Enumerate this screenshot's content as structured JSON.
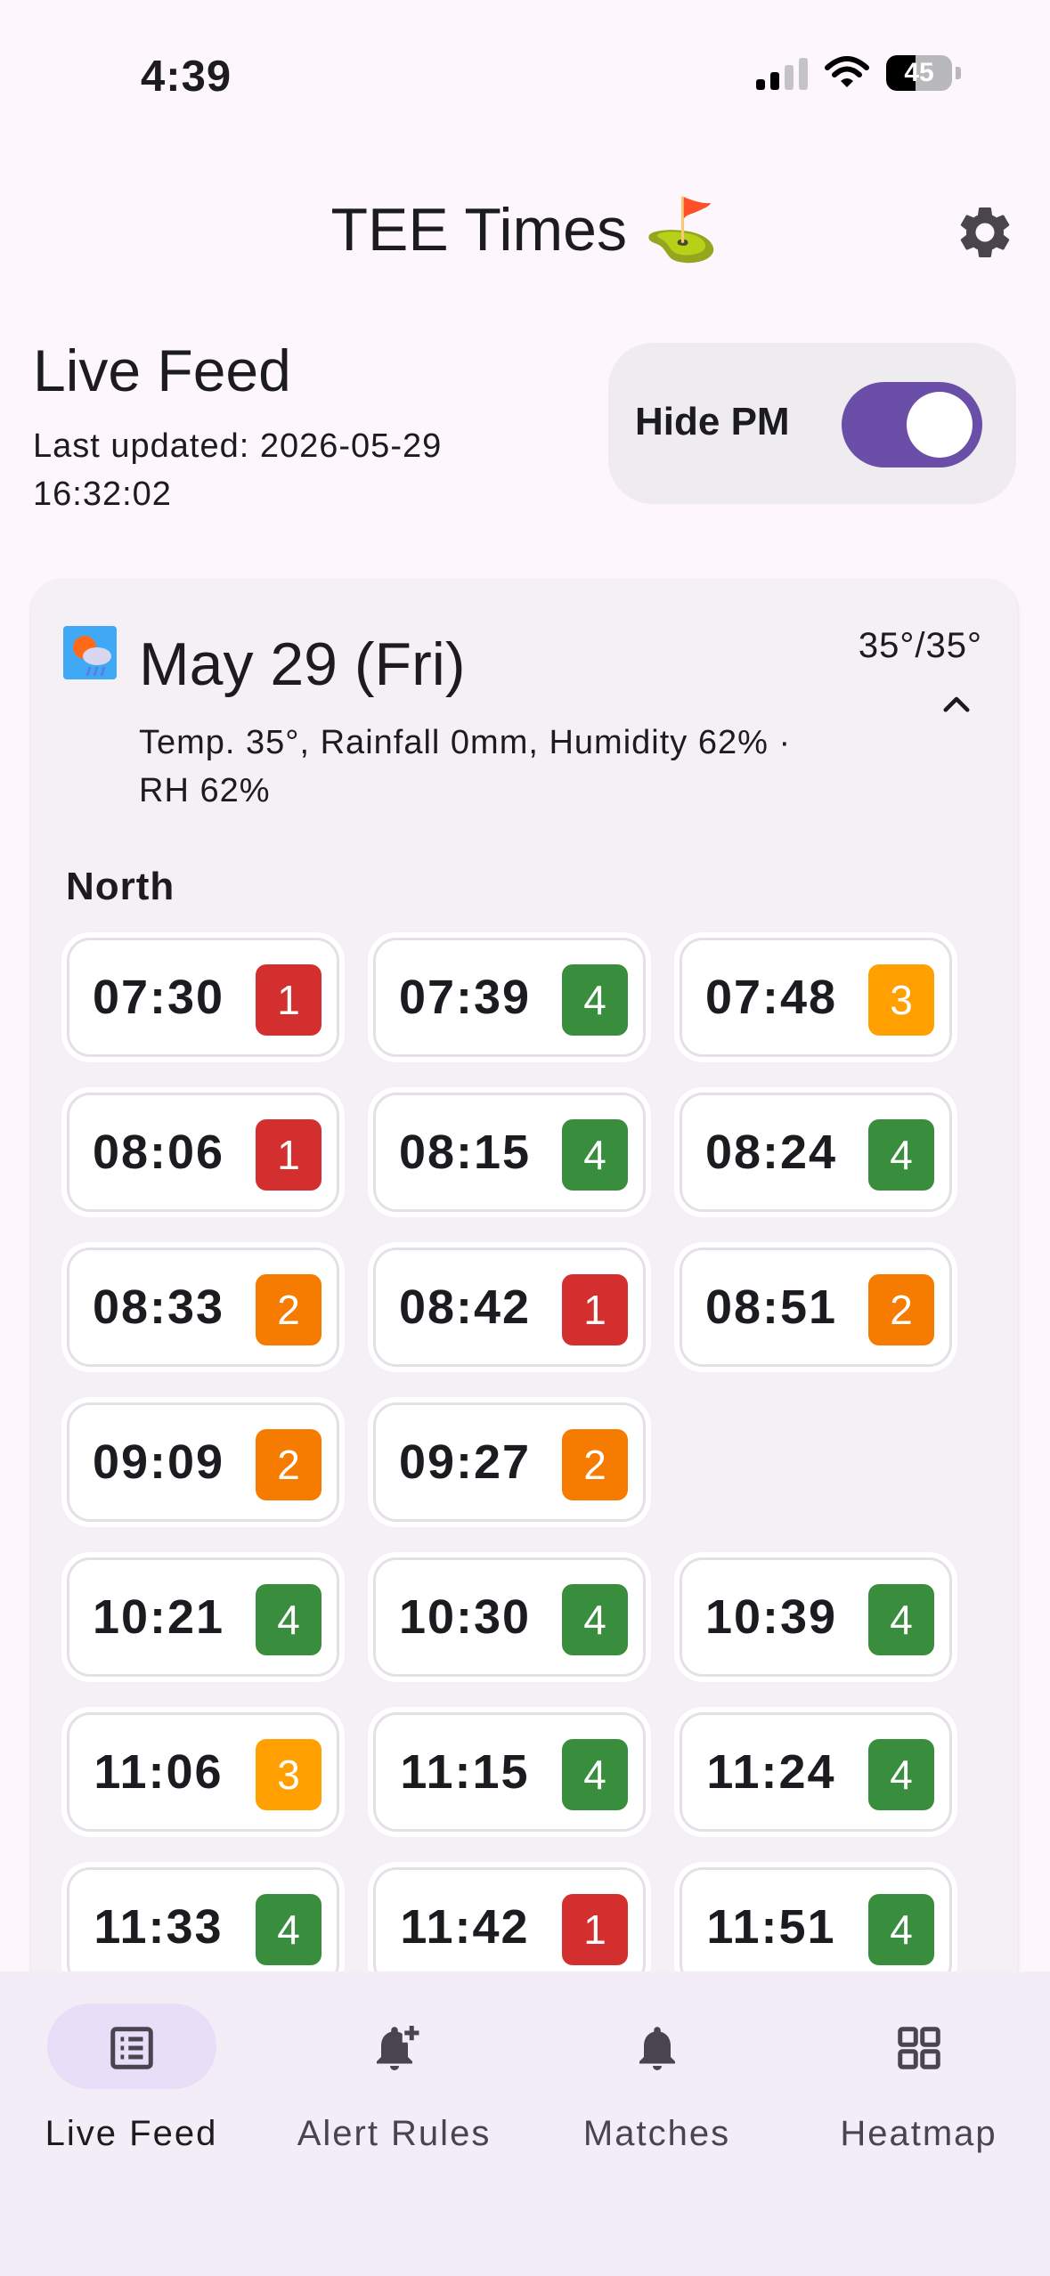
{
  "status": {
    "time": "4:39",
    "battery": "45",
    "battery_level": 0.45
  },
  "header": {
    "title": "TEE Times ⛳"
  },
  "feed": {
    "title": "Live Feed",
    "last_updated": "Last updated: 2026-05-29 16:32:02",
    "hide_pm_label": "Hide PM",
    "hide_pm_on": true
  },
  "day": {
    "title": "May 29 (Fri)",
    "temp_range": "35°/35°",
    "weather": "Temp. 35°, Rainfall 0mm, Humidity 62% · RH 62%",
    "section": "North"
  },
  "colors": {
    "red": "#d32f2f",
    "green": "#388e3c",
    "orange": "#f57c00",
    "amber": "#ffa000",
    "accent": "#6a4ea8"
  },
  "slots": [
    {
      "time": "07:30",
      "count": "1",
      "color": "red"
    },
    {
      "time": "07:39",
      "count": "4",
      "color": "green"
    },
    {
      "time": "07:48",
      "count": "3",
      "color": "amber"
    },
    {
      "time": "08:06",
      "count": "1",
      "color": "red"
    },
    {
      "time": "08:15",
      "count": "4",
      "color": "green"
    },
    {
      "time": "08:24",
      "count": "4",
      "color": "green"
    },
    {
      "time": "08:33",
      "count": "2",
      "color": "orange"
    },
    {
      "time": "08:42",
      "count": "1",
      "color": "red"
    },
    {
      "time": "08:51",
      "count": "2",
      "color": "orange"
    },
    {
      "time": "09:09",
      "count": "2",
      "color": "orange"
    },
    {
      "time": "09:27",
      "count": "2",
      "color": "orange"
    },
    null,
    {
      "time": "10:21",
      "count": "4",
      "color": "green"
    },
    {
      "time": "10:30",
      "count": "4",
      "color": "green"
    },
    {
      "time": "10:39",
      "count": "4",
      "color": "green"
    },
    {
      "time": "11:06",
      "count": "3",
      "color": "amber"
    },
    {
      "time": "11:15",
      "count": "4",
      "color": "green"
    },
    {
      "time": "11:24",
      "count": "4",
      "color": "green"
    },
    {
      "time": "11:33",
      "count": "4",
      "color": "green"
    },
    {
      "time": "11:42",
      "count": "1",
      "color": "red"
    },
    {
      "time": "11:51",
      "count": "4",
      "color": "green"
    }
  ],
  "nav": [
    {
      "label": "Live Feed",
      "icon": "list-icon",
      "active": true
    },
    {
      "label": "Alert Rules",
      "icon": "bell-plus-icon",
      "active": false
    },
    {
      "label": "Matches",
      "icon": "bell-icon",
      "active": false
    },
    {
      "label": "Heatmap",
      "icon": "grid-icon",
      "active": false
    }
  ]
}
